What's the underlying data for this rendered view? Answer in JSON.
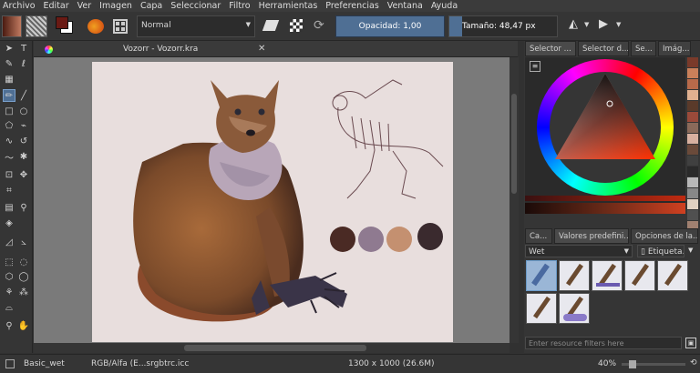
{
  "menu": [
    "Archivo",
    "Editar",
    "Ver",
    "Imagen",
    "Capa",
    "Seleccionar",
    "Filtro",
    "Herramientas",
    "Preferencias",
    "Ventana",
    "Ayuda"
  ],
  "toolbar": {
    "blend_mode": "Normal",
    "opacity_label": "Opacidad:  1,00",
    "size_label": "Tamaño:  48,47 px"
  },
  "document": {
    "tab_title": "Vozorr - Vozorr.kra"
  },
  "right_dock": {
    "top_tabs": [
      "Selector ...",
      "Selector d...",
      "Se...",
      "Imág..."
    ],
    "bottom_tabs": [
      "Ca...",
      "Valores predefini...",
      "Opciones de la..."
    ],
    "preset_filter": "Wet",
    "tag_button": "Etiqueta...",
    "search_placeholder": "Enter resource filters here"
  },
  "status": {
    "brush_name": "Basic_wet",
    "color_space": "RGB/Alfa (E...srgbtrc.icc",
    "image_size": "1300 x 1000 (26.6M)",
    "zoom": "40%"
  },
  "colors": {
    "palette_swatches": [
      "#4a2a24",
      "#8f7a90",
      "#c49070",
      "#3a2a2e"
    ],
    "history_colors": [
      "#7a3a2a",
      "#c9805a",
      "#b86a4a",
      "#e0b090",
      "#5a3a2a",
      "#9a4a3a",
      "#8a6a5a",
      "#d8b0a0",
      "#6a4a3a",
      "#404040",
      "#2a2a2a",
      "#b8b8b8",
      "#888888",
      "#e0d0c0",
      "#505050",
      "#a08070"
    ]
  }
}
